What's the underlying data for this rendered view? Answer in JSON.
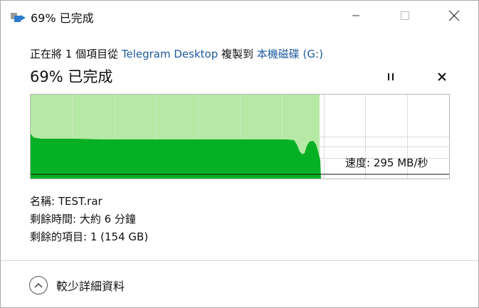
{
  "window": {
    "title": "69% 已完成",
    "minimize_icon": "minimize-icon",
    "maximize_icon": "maximize-icon",
    "close_icon": "close-icon"
  },
  "header": {
    "copy_prefix": "正在將 1 個項目從 ",
    "source": "Telegram Desktop",
    "copy_middle": " 複製到 ",
    "destination": "本機磁碟 (G:)",
    "percent_complete": "69% 已完成",
    "progress_fraction": 0.69
  },
  "controls": {
    "pause_icon": "pause-icon",
    "cancel_icon": "cancel-icon"
  },
  "graph": {
    "speed_label": "速度: 295 MB/秒",
    "fill_color": "#06b025",
    "bg_color": "#b5e9a5",
    "gridline_color": "#d4ecd0"
  },
  "details": {
    "name_label": "名稱:",
    "name_value": "TEST.rar",
    "time_label": "剩餘時間:",
    "time_value": "大約 6 分鐘",
    "items_label": "剩餘的項目:",
    "items_value": "1 (154 GB)"
  },
  "footer": {
    "less_details_label": "較少詳細資料",
    "chevron_icon": "chevron-up-icon"
  }
}
